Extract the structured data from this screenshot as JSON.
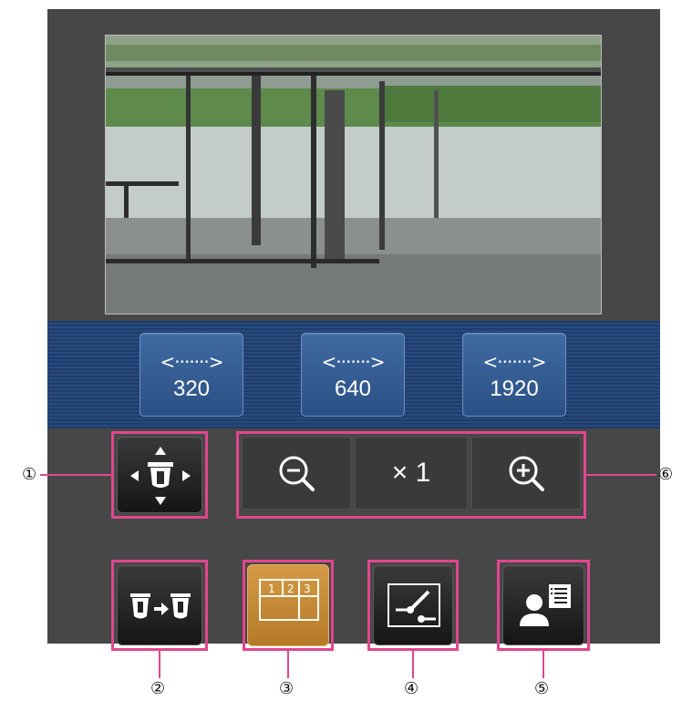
{
  "resolution_buttons": [
    {
      "arrow": "<·······>",
      "value": "320"
    },
    {
      "arrow": "<·······>",
      "value": "640"
    },
    {
      "arrow": "<·······>",
      "value": "1920"
    }
  ],
  "zoom": {
    "level_label": "× 1"
  },
  "callouts": {
    "c1": "①",
    "c2": "②",
    "c3": "③",
    "c4": "④",
    "c5": "⑤",
    "c6": "⑥"
  },
  "colors": {
    "panel": "#474747",
    "resolution_bar": "#274a7e",
    "highlight": "#e0468f",
    "multiscreen_active": "#c08530"
  },
  "icons": [
    "pan-tilt-control-icon",
    "camera-switch-icon",
    "multiscreen-icon",
    "brightness-adjust-icon",
    "user-list-icon",
    "zoom-out-icon",
    "zoom-in-icon"
  ]
}
